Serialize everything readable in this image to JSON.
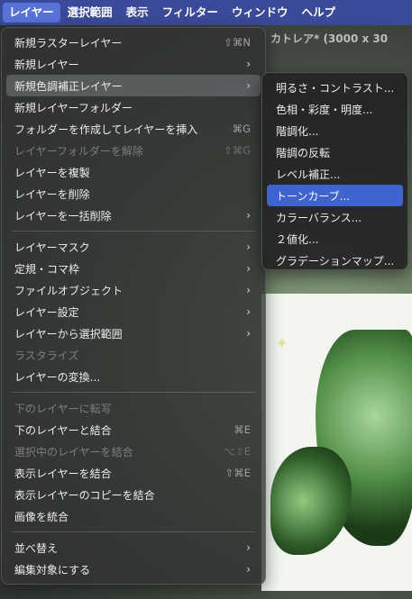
{
  "menubar": {
    "items": [
      {
        "label": "レイヤー"
      },
      {
        "label": "選択範囲"
      },
      {
        "label": "表示"
      },
      {
        "label": "フィルター"
      },
      {
        "label": "ウィンドウ"
      },
      {
        "label": "ヘルプ"
      }
    ]
  },
  "document": {
    "title": "カトレア* (3000 x 30"
  },
  "layer_menu": {
    "items": [
      {
        "label": "新規ラスターレイヤー",
        "shortcut": "⇧⌘N"
      },
      {
        "label": "新規レイヤー",
        "submenu": "›"
      },
      {
        "label": "新規色調補正レイヤー",
        "submenu": "›"
      },
      {
        "label": "新規レイヤーフォルダー"
      },
      {
        "label": "フォルダーを作成してレイヤーを挿入",
        "shortcut": "⌘G"
      },
      {
        "label": "レイヤーフォルダーを解除",
        "shortcut": "⇧⌘G"
      },
      {
        "label": "レイヤーを複製"
      },
      {
        "label": "レイヤーを削除"
      },
      {
        "label": "レイヤーを一括削除",
        "submenu": "›"
      },
      {
        "label": "レイヤーマスク",
        "submenu": "›"
      },
      {
        "label": "定規・コマ枠",
        "submenu": "›"
      },
      {
        "label": "ファイルオブジェクト",
        "submenu": "›"
      },
      {
        "label": "レイヤー設定",
        "submenu": "›"
      },
      {
        "label": "レイヤーから選択範囲",
        "submenu": "›"
      },
      {
        "label": "ラスタライズ"
      },
      {
        "label": "レイヤーの変換..."
      },
      {
        "label": "下のレイヤーに転写"
      },
      {
        "label": "下のレイヤーと結合",
        "shortcut": "⌘E"
      },
      {
        "label": "選択中のレイヤーを結合",
        "shortcut": "⌥⇧E"
      },
      {
        "label": "表示レイヤーを結合",
        "shortcut": "⇧⌘E"
      },
      {
        "label": "表示レイヤーのコピーを結合"
      },
      {
        "label": "画像を統合"
      },
      {
        "label": "並べ替え",
        "submenu": "›"
      },
      {
        "label": "編集対象にする",
        "submenu": "›"
      }
    ]
  },
  "adjustment_submenu": {
    "items": [
      {
        "label": "明るさ・コントラスト..."
      },
      {
        "label": "色相・彩度・明度..."
      },
      {
        "label": "階調化..."
      },
      {
        "label": "階調の反転"
      },
      {
        "label": "レベル補正..."
      },
      {
        "label": "トーンカーブ..."
      },
      {
        "label": "カラーバランス..."
      },
      {
        "label": "２値化..."
      },
      {
        "label": "グラデーションマップ..."
      }
    ]
  },
  "colors": {
    "menubar": "#3b4a98",
    "active_menu": "#5773d8",
    "selection": "#3f63cf"
  }
}
